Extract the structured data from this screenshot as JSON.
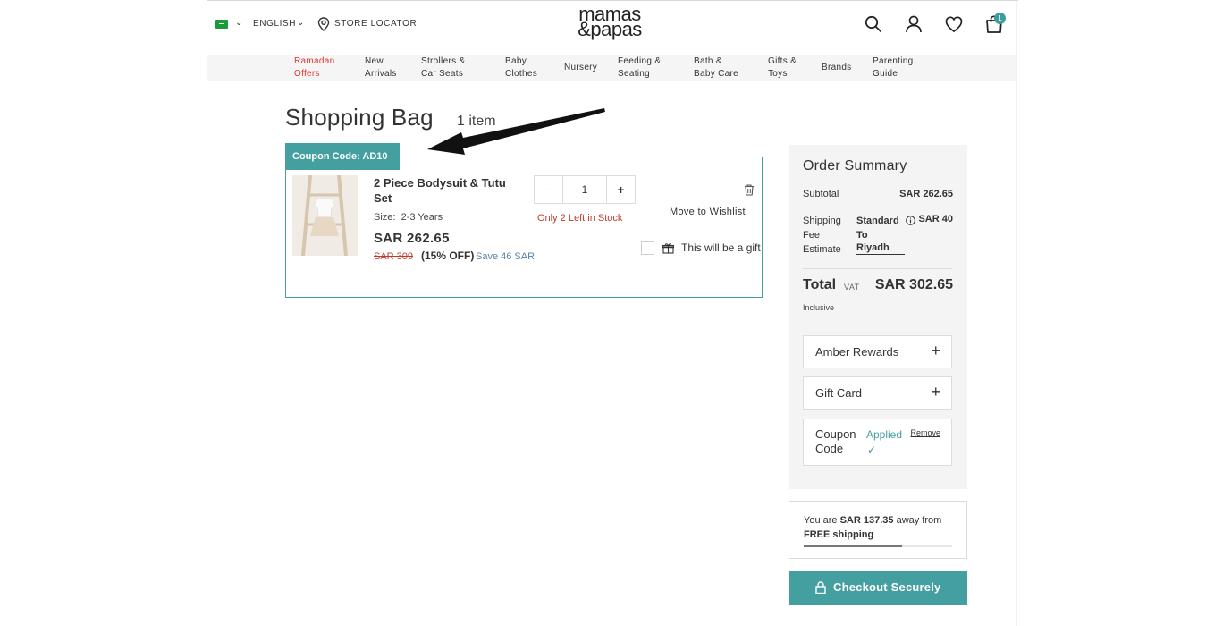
{
  "header": {
    "language": "ENGLISH",
    "store_locator": "STORE LOCATOR",
    "logo_line1": "mamas",
    "logo_line2": "&papas",
    "cart_count": "1",
    "brand_color": "#439fa0"
  },
  "nav": {
    "items": [
      {
        "line1": "Ramadan",
        "line2": "Offers"
      },
      {
        "line1": "New",
        "line2": "Arrivals"
      },
      {
        "line1": "Strollers &",
        "line2": "Car Seats"
      },
      {
        "line1": "Baby",
        "line2": "Clothes"
      },
      {
        "line1": "Nursery",
        "line2": ""
      },
      {
        "line1": "Feeding &",
        "line2": "Seating"
      },
      {
        "line1": "Bath &",
        "line2": "Baby Care"
      },
      {
        "line1": "Gifts &",
        "line2": "Toys"
      },
      {
        "line1": "Brands",
        "line2": ""
      },
      {
        "line1": "Parenting",
        "line2": "Guide"
      }
    ]
  },
  "bag": {
    "title": "Shopping Bag",
    "item_count": "1 item",
    "coupon_tag": "Coupon Code: AD10"
  },
  "item": {
    "name": "2 Piece Bodysuit & Tutu Set",
    "size_label": "Size:",
    "size_value": "2-3 Years",
    "price": "SAR 262.65",
    "old_price": "SAR 309",
    "discount": "(15% OFF)",
    "save": "Save 46 SAR",
    "qty_minus": "−",
    "qty_value": "1",
    "qty_plus": "+",
    "stock": "Only 2 Left in Stock",
    "wishlist": "Move to Wishlist",
    "gift": "This will be a gift"
  },
  "summary": {
    "title": "Order Summary",
    "subtotal_label": "Subtotal",
    "subtotal_value": "SAR 262.65",
    "shipping_label": "Shipping Fee Estimate",
    "shipping_method": "Standard To",
    "shipping_value": "SAR 40",
    "city": "Riyadh",
    "total_label": "Total",
    "vat": "VAT",
    "total_value": "SAR 302.65",
    "inclusive": "Inclusive",
    "amber_rewards": "Amber Rewards",
    "gift_card": "Gift Card",
    "coupon_label": "Coupon Code",
    "coupon_status": "Applied",
    "coupon_remove": "Remove",
    "coupon_check": "✓"
  },
  "free_shipping": {
    "prefix": "You are ",
    "amount": "SAR 137.35",
    "middle": " away from ",
    "free": "FREE",
    "suffix": " shipping",
    "progress_percent": 66
  },
  "checkout": {
    "label": "Checkout Securely"
  }
}
